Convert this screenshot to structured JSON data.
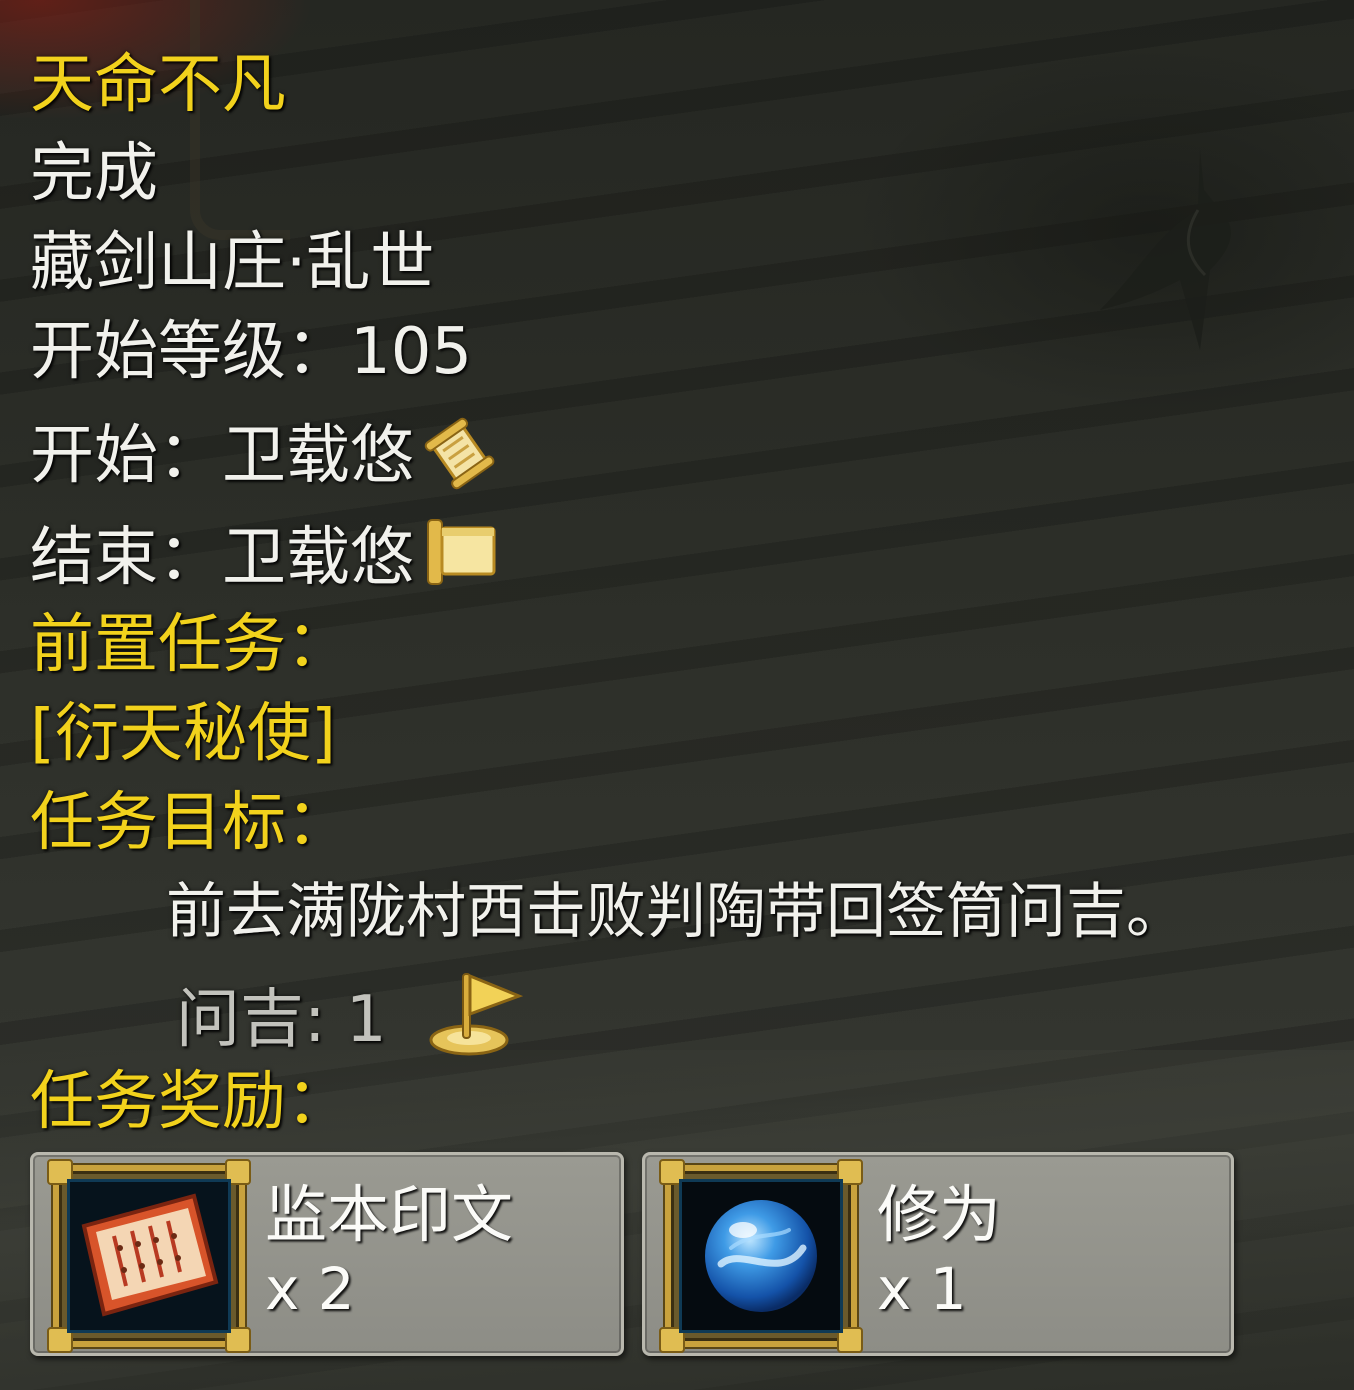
{
  "quest": {
    "title": "天命不凡",
    "status": "完成",
    "location": "藏剑山庄·乱世",
    "start_level": "开始等级：105",
    "start_npc": "开始：卫载悠",
    "end_npc": "结束：卫载悠",
    "prereq_header": "前置任务：",
    "prereq_quest": "[衍天秘使]",
    "objective_header": "任务目标：",
    "objective_text": "前去满陇村西击败判陶带回签筒问吉。",
    "progress_text": "问吉: 1",
    "rewards_header": "任务奖励："
  },
  "rewards": [
    {
      "name": "监本印文",
      "qty": "x 2",
      "icon": "book-reward-icon"
    },
    {
      "name": "修为",
      "qty": "x 1",
      "icon": "blue-orb-icon"
    }
  ],
  "icons": {
    "start": "scroll-quest-start-icon",
    "end": "scroll-quest-end-icon",
    "objective": "flag-marker-icon"
  },
  "colors": {
    "highlight": "#f2d21c",
    "text": "#f1f1ec",
    "muted": "#c2c2bc"
  }
}
